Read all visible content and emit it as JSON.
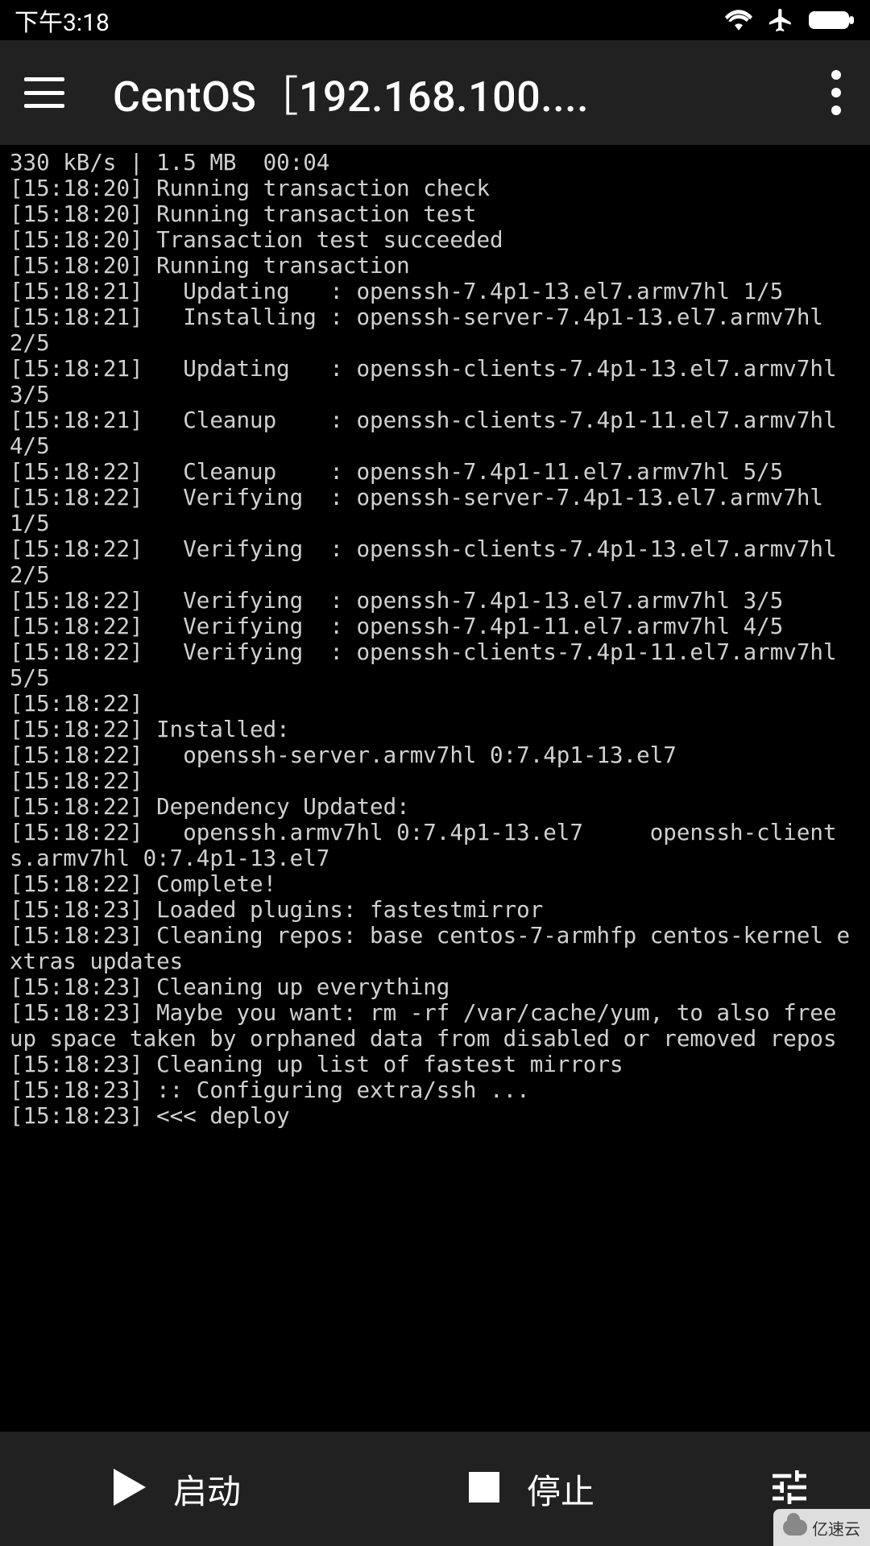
{
  "statusbar": {
    "time": "下午3:18"
  },
  "appbar": {
    "title": "CentOS［192.168.100...."
  },
  "terminal": {
    "text": "330 kB/s | 1.5 MB  00:04\n[15:18:20] Running transaction check\n[15:18:20] Running transaction test\n[15:18:20] Transaction test succeeded\n[15:18:20] Running transaction\n[15:18:21]   Updating   : openssh-7.4p1-13.el7.armv7hl 1/5\n[15:18:21]   Installing : openssh-server-7.4p1-13.el7.armv7hl                       2/5\n[15:18:21]   Updating   : openssh-clients-7.4p1-13.el7.armv7hl                      3/5\n[15:18:21]   Cleanup    : openssh-clients-7.4p1-11.el7.armv7hl                      4/5\n[15:18:22]   Cleanup    : openssh-7.4p1-11.el7.armv7hl 5/5\n[15:18:22]   Verifying  : openssh-server-7.4p1-13.el7.armv7hl                       1/5\n[15:18:22]   Verifying  : openssh-clients-7.4p1-13.el7.armv7hl                      2/5\n[15:18:22]   Verifying  : openssh-7.4p1-13.el7.armv7hl 3/5\n[15:18:22]   Verifying  : openssh-7.4p1-11.el7.armv7hl 4/5\n[15:18:22]   Verifying  : openssh-clients-7.4p1-11.el7.armv7hl                      5/5\n[15:18:22]\n[15:18:22] Installed:\n[15:18:22]   openssh-server.armv7hl 0:7.4p1-13.el7\n[15:18:22]\n[15:18:22] Dependency Updated:\n[15:18:22]   openssh.armv7hl 0:7.4p1-13.el7     openssh-clients.armv7hl 0:7.4p1-13.el7\n[15:18:22] Complete!\n[15:18:23] Loaded plugins: fastestmirror\n[15:18:23] Cleaning repos: base centos-7-armhfp centos-kernel extras updates\n[15:18:23] Cleaning up everything\n[15:18:23] Maybe you want: rm -rf /var/cache/yum, to also free up space taken by orphaned data from disabled or removed repos\n[15:18:23] Cleaning up list of fastest mirrors\n[15:18:23] :: Configuring extra/ssh ...\n[15:18:23] <<< deploy"
  },
  "bottombar": {
    "start_label": "启动",
    "stop_label": "停止"
  },
  "watermark": {
    "text": "亿速云"
  }
}
